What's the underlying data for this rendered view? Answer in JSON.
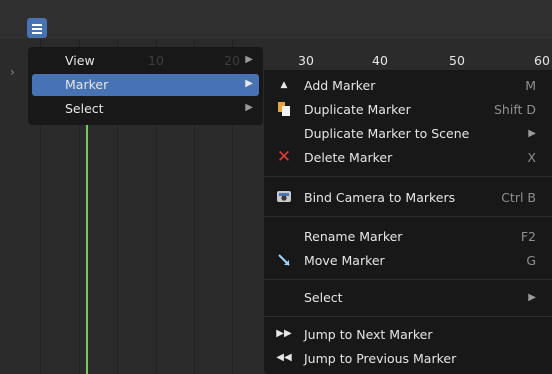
{
  "header": {
    "menu_button_icon": "hamburger-menu-icon"
  },
  "timeline": {
    "ruler_labels": [
      "30",
      "40",
      "50",
      "60"
    ],
    "ghost_labels": [
      "10",
      "20"
    ],
    "current_frame_color": "#6fd152"
  },
  "left_menu": {
    "items": [
      {
        "label": "View",
        "submenu": true,
        "active": false
      },
      {
        "label": "Marker",
        "submenu": true,
        "active": true
      },
      {
        "label": "Select",
        "submenu": true,
        "active": false
      }
    ]
  },
  "marker_menu": {
    "items": [
      {
        "label": "Add Marker",
        "shortcut": "M",
        "icon": "add-marker-icon"
      },
      {
        "label": "Duplicate Marker",
        "shortcut": "Shift D",
        "icon": "duplicate-icon"
      },
      {
        "label": "Duplicate Marker to Scene",
        "submenu": true,
        "icon": ""
      },
      {
        "label": "Delete Marker",
        "shortcut": "X",
        "icon": "delete-x-icon"
      },
      {
        "label": "Bind Camera to Markers",
        "shortcut": "Ctrl B",
        "icon": "camera-icon"
      },
      {
        "label": "Rename Marker",
        "shortcut": "F2",
        "icon": ""
      },
      {
        "label": "Move Marker",
        "shortcut": "G",
        "icon": "move-arrow-icon"
      },
      {
        "label": "Select",
        "submenu": true,
        "icon": ""
      },
      {
        "label": "Jump to Next Marker",
        "icon": "next-marker-icon"
      },
      {
        "label": "Jump to Previous Marker",
        "icon": "previous-marker-icon"
      }
    ]
  },
  "colors": {
    "accent": "#4772b3",
    "menu_bg": "#181818",
    "delete_icon": "#e23a3a"
  }
}
